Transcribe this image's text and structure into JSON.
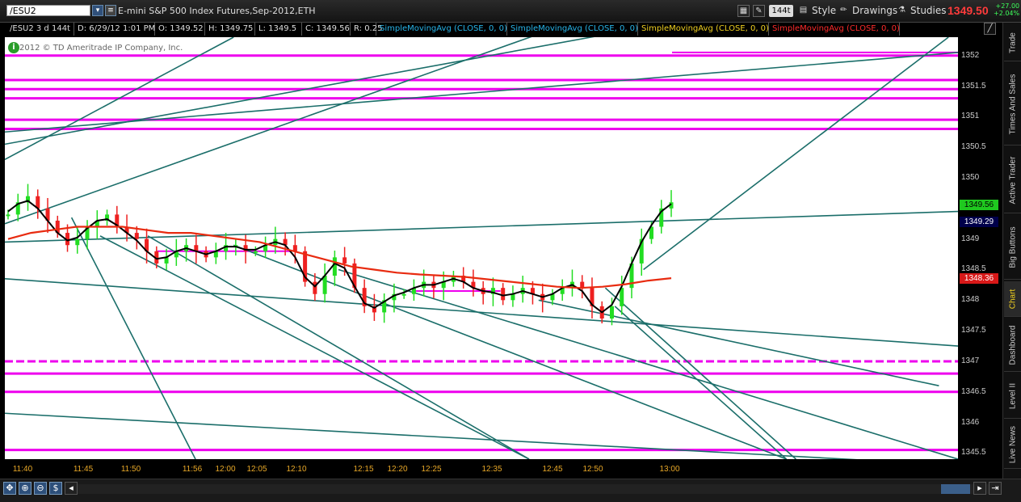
{
  "toolbar": {
    "symbol": "/ESU2",
    "description": "E-mini S&P 500 Index Futures,Sep-2012,ETH",
    "aggregation": "144t",
    "style_label": "Style",
    "drawings_label": "Drawings",
    "studies_label": "Studies",
    "last_price": "1349.50",
    "change": "+27.00",
    "change_pct": "+2.04%"
  },
  "info_bar": {
    "symbol_period": "/ESU2 3 d 144t",
    "datetime": "D: 6/29/12 1:01 PM",
    "open": "O: 1349.52",
    "high": "H: 1349.75",
    "low": "L: 1349.5",
    "close": "C: 1349.56",
    "range": "R: 0.25",
    "studies": [
      {
        "label": "SimpleMovingAvg (CLOSE, 0, 0)",
        "color": "#27b4e8"
      },
      {
        "label": "SimpleMovingAvg (CLOSE, 0, 0)",
        "color": "#27b4e8"
      },
      {
        "label": "SimpleMovingAvg (CLOSE, 0, 0)",
        "color": "#f0d020"
      },
      {
        "label": "SimpleMovingAvg (CLOSE, 0, 0)",
        "color": "#ff2a2a"
      }
    ]
  },
  "copyright": "2012 © TD Ameritrade IP Company, Inc.",
  "side_tabs": [
    "Trade",
    "Times And Sales",
    "Active Trader",
    "Big Buttons",
    "Chart",
    "Dashboard",
    "Level II",
    "Live News"
  ],
  "price_labels": {
    "last": "1349.56",
    "sma_black": "1349.29",
    "sma_red": "1348.36"
  },
  "colors": {
    "up": "#22dd22",
    "down": "#ee2020",
    "sma_red": "#e82b10",
    "sma_black": "#000000",
    "trendline": "#1b6e6a",
    "level": "#ee00ee"
  },
  "chart_data": {
    "type": "candlestick",
    "instrument": "/ESU2",
    "y_range": [
      1345.4,
      1352.3
    ],
    "y_ticks": [
      "1352",
      "1351.5",
      "1351",
      "1350.5",
      "1350",
      "1349",
      "1348.5",
      "1348",
      "1347.5",
      "1347",
      "1346.5",
      "1346",
      "1345.5"
    ],
    "x_ticks": [
      "11:40",
      "11:45",
      "11:50",
      "11:56",
      "12:00",
      "12:05",
      "12:10",
      "12:15",
      "12:20",
      "12:25",
      "12:35",
      "12:45",
      "12:50",
      "13:00"
    ],
    "close_series": [
      1349.4,
      1349.6,
      1349.7,
      1349.5,
      1349.3,
      1349.1,
      1348.9,
      1349.0,
      1349.2,
      1349.3,
      1349.4,
      1349.2,
      1349.1,
      1349.0,
      1348.8,
      1348.6,
      1348.7,
      1348.8,
      1348.9,
      1348.8,
      1348.7,
      1348.8,
      1348.9,
      1348.9,
      1348.8,
      1348.8,
      1348.9,
      1349.0,
      1348.9,
      1348.8,
      1348.3,
      1348.1,
      1348.4,
      1348.7,
      1348.6,
      1348.2,
      1347.9,
      1347.8,
      1348.0,
      1348.1,
      1348.1,
      1348.2,
      1348.3,
      1348.2,
      1348.3,
      1348.4,
      1348.3,
      1348.2,
      1348.1,
      1348.2,
      1348.0,
      1348.1,
      1348.2,
      1348.1,
      1348.0,
      1348.1,
      1348.2,
      1348.3,
      1348.2,
      1347.9,
      1347.7,
      1347.9,
      1348.2,
      1348.6,
      1349.0,
      1349.2,
      1349.5,
      1349.6
    ],
    "sma_red": [
      1349.0,
      1349.1,
      1349.15,
      1349.2,
      1349.2,
      1349.2,
      1349.15,
      1349.1,
      1349.1,
      1349.05,
      1349.0,
      1348.95,
      1348.85,
      1348.75,
      1348.65,
      1348.55,
      1348.5,
      1348.45,
      1348.42,
      1348.4,
      1348.38,
      1348.34,
      1348.3,
      1348.26,
      1348.22,
      1348.2,
      1348.22,
      1348.26,
      1348.32,
      1348.36
    ],
    "levels": [
      1352.0,
      1351.6,
      1351.45,
      1351.3,
      1350.95,
      1350.8,
      1347.0,
      1346.8,
      1346.5,
      1345.55
    ],
    "dashed_levels": [
      1347.0
    ],
    "short_levels": [
      {
        "price": 1352.05,
        "from": 0.7,
        "to": 1.0
      },
      {
        "price": 1351.6,
        "from": 0.58,
        "to": 1.0
      },
      {
        "price": 1348.8,
        "from": 0.16,
        "to": 0.3
      },
      {
        "price": 1348.15,
        "from": 0.43,
        "to": 0.52
      }
    ],
    "trendlines": [
      [
        1348.95,
        0.0,
        1349.45,
        1.0
      ],
      [
        1348.35,
        0.0,
        1347.25,
        1.0
      ],
      [
        1346.15,
        0.0,
        1345.3,
        1.0
      ],
      [
        1350.75,
        0.0,
        1352.05,
        1.0
      ],
      [
        1350.55,
        0.0,
        1352.4,
        0.65
      ],
      [
        1349.25,
        0.0,
        1352.35,
        0.56
      ],
      [
        1350.3,
        0.0,
        1352.3,
        0.24
      ],
      [
        1349.35,
        0.07,
        1345.4,
        0.2
      ],
      [
        1349.05,
        0.1,
        1345.4,
        0.55
      ],
      [
        1349.05,
        0.15,
        1345.4,
        0.55
      ],
      [
        1348.9,
        0.24,
        1345.4,
        0.82
      ],
      [
        1348.5,
        0.35,
        1345.4,
        1.0
      ],
      [
        1348.0,
        0.56,
        1346.6,
        0.98
      ],
      [
        1348.2,
        0.63,
        1345.4,
        0.83
      ],
      [
        1347.9,
        0.64,
        1345.4,
        0.82
      ],
      [
        1348.5,
        0.67,
        1352.3,
        0.99
      ]
    ]
  }
}
